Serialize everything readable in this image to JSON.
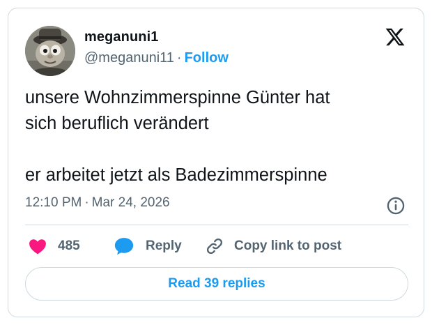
{
  "author": {
    "display_name": "meganuni1",
    "handle": "@meganuni11",
    "separator": "·",
    "follow_label": "Follow"
  },
  "tweet": {
    "lines": [
      "unsere Wohnzimmerspinne Günter hat",
      "sich beruflich verändert",
      "er arbeitet jetzt als Badezimmerspinne"
    ],
    "time": "12:10 PM",
    "separator": "·",
    "date": "Mar 24, 2026"
  },
  "actions": {
    "like_count": "485",
    "reply_label": "Reply",
    "copy_label": "Copy link to post"
  },
  "replies_button": {
    "label": "Read 39 replies"
  },
  "colors": {
    "accent": "#1d9bf0",
    "like": "#f91880",
    "text": "#0f1419",
    "muted": "#536471",
    "border": "#cfd9de"
  },
  "icons": [
    "avatar",
    "x-logo-icon",
    "info-icon",
    "heart-icon",
    "reply-bubble-icon",
    "link-icon"
  ]
}
